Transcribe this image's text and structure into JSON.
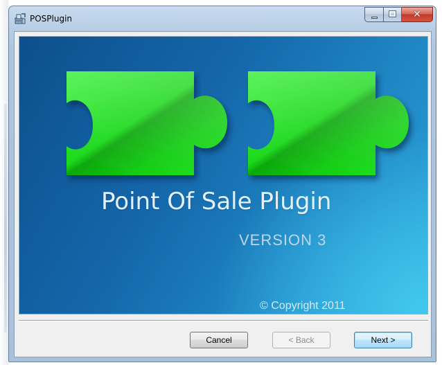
{
  "window": {
    "title": "POSPlugin",
    "icon": "installer-package-icon",
    "controls": [
      "minimize-icon",
      "maximize-icon",
      "close-icon"
    ]
  },
  "banner": {
    "title": "Point Of Sale Plugin",
    "version": "VERSION 3",
    "copyright": "© Copyright 2011",
    "graphic": "puzzle-pieces-icon",
    "colors": {
      "background": "#1467aa",
      "accent": "#42c8ee",
      "puzzle": "#1ee01e"
    }
  },
  "buttons": {
    "cancel": "Cancel",
    "back": "< Back",
    "next": "Next >"
  }
}
